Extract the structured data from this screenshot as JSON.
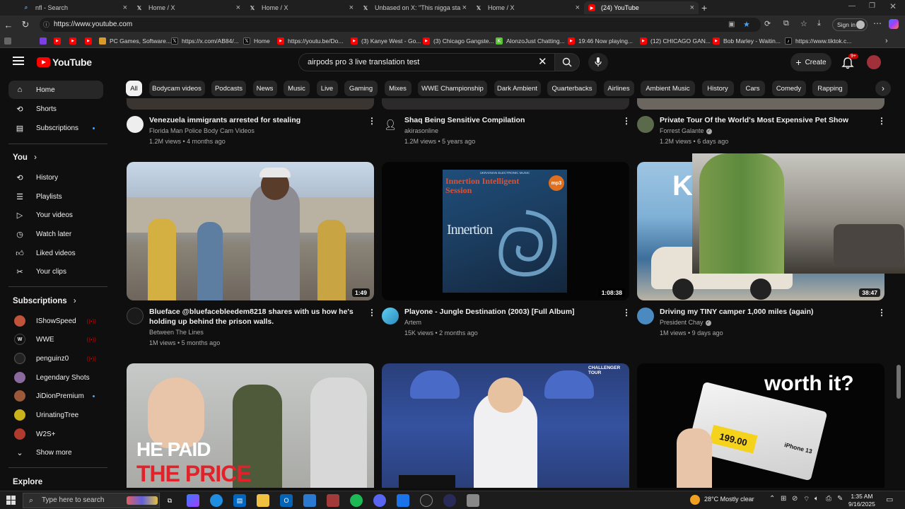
{
  "browser": {
    "tabs": [
      {
        "title": "nfl - Search",
        "icon": "search-icon"
      },
      {
        "title": "Home / X",
        "icon": "x-logo-icon"
      },
      {
        "title": "Home / X",
        "icon": "x-logo-icon"
      },
      {
        "title": "Unbased  on X: \"This nigga sta",
        "icon": "x-logo-icon"
      },
      {
        "title": "Home / X",
        "icon": "x-logo-icon"
      },
      {
        "title": "(24) YouTube",
        "icon": "youtube-icon"
      }
    ],
    "url": "https://www.youtube.com",
    "signin_label": "Sign in",
    "bookmarks": [
      "PC Games, Software...",
      "https://x.com/AB84/...",
      "Home",
      "https://youtu.be/Do...",
      "(3) Kanye West - Go...",
      "(3) Chicago Gangste...",
      "AlonzoJust Chatting...",
      "19:46 Now playing...",
      "(12) CHICAGO GAN...",
      "Bob Marley - Waitin...",
      "https://www.tiktok.c..."
    ]
  },
  "youtube": {
    "logo": "YouTube",
    "search_query": "airpods pro 3 live translation test",
    "create_label": "Create",
    "notif_badge": "9+",
    "chips": [
      "All",
      "Bodycam videos",
      "Podcasts",
      "News",
      "Music",
      "Live",
      "Gaming",
      "Mixes",
      "WWE Championship",
      "Dark Ambient",
      "Quarterbacks",
      "Airlines",
      "Ambient Music",
      "History",
      "Cars",
      "Comedy",
      "Rapping"
    ],
    "sidebar": {
      "main": [
        "Home",
        "Shorts",
        "Subscriptions"
      ],
      "you_heading": "You",
      "you_items": [
        "History",
        "Playlists",
        "Your videos",
        "Watch later",
        "Liked videos",
        "Your clips"
      ],
      "subs_heading": "Subscriptions",
      "subs": [
        "IShowSpeed",
        "WWE",
        "penguinz0",
        "Legendary Shots",
        "JiDionPremium",
        "UrinatingTree",
        "W2S+"
      ],
      "show_more": "Show more",
      "explore": "Explore"
    },
    "videos_row1": [
      {
        "title": "Venezuela immigrants arrested for stealing",
        "channel": "Florida Man Police Body Cam Videos",
        "meta": "1.2M views • 4 months ago"
      },
      {
        "title": "Shaq Being Sensitive Compilation",
        "channel": "akirasonline",
        "meta": "1.2M views • 5 years ago"
      },
      {
        "title": "Private Tour Of the World's Most Expensive Pet Show",
        "channel": "Forrest Galante",
        "meta": "1.2M views • 6 days ago"
      }
    ],
    "videos_row2": [
      {
        "title_l1": "Blueface @bluefacebleedem8218 shares with us how he's",
        "title_l2": "holding up behind the prison walls.",
        "channel": "Between The Lines",
        "meta": "1M views • 5 months ago",
        "duration": "1:49"
      },
      {
        "title_l1": "Playone - Jungle Destination (2003) [Full Album]",
        "title_l2": "",
        "channel": "Artem",
        "meta": "15K views • 2 months ago",
        "duration": "1:08:38",
        "thumb_text": {
          "top": "UKRAINIAN ELECTRONIC MUSIC",
          "title1": "Innertion Intelligent",
          "title2": "Session",
          "brand": "Innertion",
          "badge": "mp3"
        }
      },
      {
        "title_l1": "Driving my TINY camper 1,000 miles (again)",
        "title_l2": "",
        "channel": "President Chay",
        "meta": "1M views • 9 days ago",
        "duration": "38:47"
      }
    ],
    "row3_thumbs": {
      "left_text1": "HE PAID",
      "left_text2": "THE PRICE",
      "mid_badge": "CHALLENGER TOUR",
      "right_text": "worth it?",
      "right_price": "199.00",
      "right_label": "iPhone 13"
    }
  },
  "taskbar": {
    "search_placeholder": "Type here to search",
    "weather": "28°C  Mostly clear",
    "time": "1:35 AM",
    "date": "9/16/2025"
  }
}
